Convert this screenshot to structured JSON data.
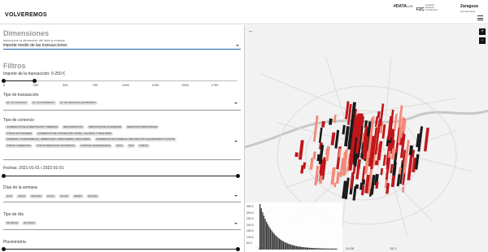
{
  "app": {
    "logo": "VOLVEREMOS",
    "brand_datalab": "#DATA",
    "brand_datalab_sub": "LAB",
    "brand_fzc": "FZC",
    "brand_fzc_text": "Fundación Zaragoza Conocimiento",
    "brand_city": "Zaragoza",
    "brand_ayto": "Ayuntamiento"
  },
  "dimensions": {
    "title": "Dimensiones",
    "hint": "seleccione la dimensión del dato a mostrar",
    "selected": "importe medio de las transacciones"
  },
  "filters": {
    "title": "Filtros",
    "amount_label": "Importe de la transacción:",
    "amount_range": "0-250 €",
    "amount_ticks": [
      "0",
      "250",
      "500",
      "750",
      "1000",
      "1250",
      "1500",
      "1750"
    ],
    "transaction_type_label": "Tipo de transacción",
    "transaction_types": [
      "op. con descuento",
      "op. con bonificación",
      "op. con descuento y bonificación"
    ],
    "commerce_type_label": "Tipo de comercio",
    "commerce_types": [
      [
        "COMERCIOS DE ALIMENTACIÓN Y BEBIDAS",
        "RESTAURACIÓN",
        "SERVICIOS DE HOSPEDAJE",
        "SERVICIOS PERSONALES"
      ],
      [
        "OTRAS ACTIVIDADES",
        "COMERCIOS DE CONFECCIÓN, MODA, CALZADO Y PELETERÍA"
      ],
      [
        "FARMACIA, PARAFARMACIA, HERBOLARIO, PERFUMERÍA, DROGUERÍA",
        "COMERCIOS DE MUEBLES, DECORACIÓN, EQUIPAMIENTO HOGAR"
      ],
      [
        "OTROS COMERCIOS",
        "OTROS SERVICIOS SANITARIOS",
        "CLÍNICAS VETERINARIAS",
        "OCIO",
        "TAXI",
        "OTROS"
      ]
    ],
    "dates_label": "Fechas: 2021-01-01 / 2022-01-01",
    "weekdays_label": "Días de la semana",
    "weekdays": [
      "lunes",
      "martes",
      "miércoles",
      "jueves",
      "viernes",
      "sábado",
      "domingo"
    ],
    "daytype_label": "Tipo de día",
    "daytypes": [
      "día laboral",
      "día festivo"
    ],
    "rain_label": "Pluviometría"
  },
  "map": {
    "zoom_in": "+",
    "zoom_out": "−",
    "back": "←",
    "hist_y_ticks": [
      "350.0",
      "300.0",
      "250.0",
      "200.0",
      "150.0",
      "100.0",
      "50.0"
    ],
    "hist_x_ticks": [
      "31.61",
      "71.49",
      "111.38",
      "151.2"
    ]
  },
  "colors": {
    "accent": "#1e66b3",
    "bar_dark": "#1a1a1a",
    "bar_red": "#c0161c",
    "bar_light": "#f28a7a"
  }
}
